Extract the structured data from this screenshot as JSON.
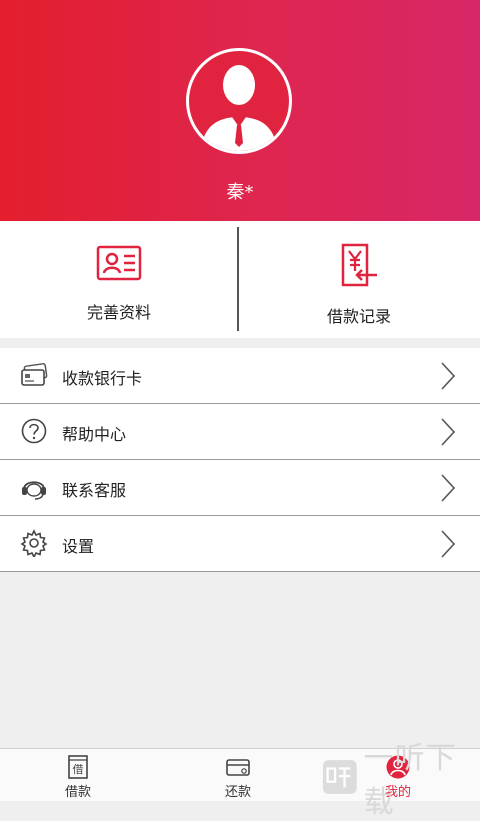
{
  "profile": {
    "username": "秦*"
  },
  "quick_actions": [
    {
      "label": "完善资料",
      "icon": "id-card-icon"
    },
    {
      "label": "借款记录",
      "icon": "yen-document-icon"
    }
  ],
  "menu": [
    {
      "label": "收款银行卡",
      "icon": "bank-card-icon"
    },
    {
      "label": "帮助中心",
      "icon": "question-circle-icon"
    },
    {
      "label": "联系客服",
      "icon": "headset-icon"
    },
    {
      "label": "设置",
      "icon": "gear-icon"
    }
  ],
  "tabbar": {
    "active": "我的",
    "tabs": [
      {
        "label": "借款",
        "icon": "loan-doc-icon",
        "icon_text": "借"
      },
      {
        "label": "还款",
        "icon": "repay-card-icon"
      },
      {
        "label": "我的",
        "icon": "user-circle-icon"
      }
    ]
  },
  "watermark": {
    "text": "一听下载"
  },
  "colors": {
    "accent": "#e0243f",
    "header_start": "#e31e2d",
    "header_end": "#d82767"
  }
}
